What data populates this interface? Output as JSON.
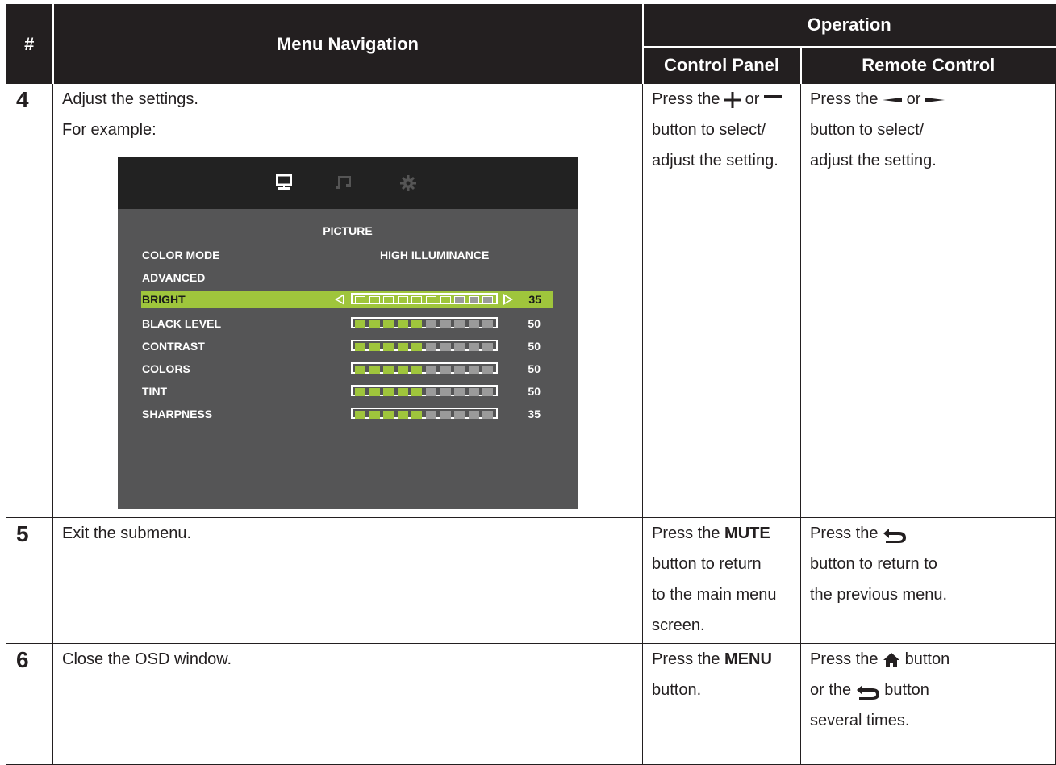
{
  "header": {
    "num": "#",
    "menu_navigation": "Menu Navigation",
    "operation": "Operation",
    "control_panel": "Control Panel",
    "remote_control": "Remote Control"
  },
  "rows": [
    {
      "num": "4",
      "nav": [
        "Adjust the settings.",
        "For example:"
      ],
      "cp": {
        "a": "Press the",
        "b": "or",
        "c": "button to select/",
        "d": "adjust the setting."
      },
      "rc": {
        "a": "Press the",
        "b": "or",
        "c": "button to select/",
        "d": "adjust the setting."
      }
    },
    {
      "num": "5",
      "nav": [
        "Exit the submenu."
      ],
      "cp": {
        "a": "Press the",
        "bold": "MUTE",
        "c": "button to return",
        "d": "to the main menu",
        "e": "screen."
      },
      "rc": {
        "a": "Press the",
        "c": "button to return to",
        "d": "the previous menu."
      }
    },
    {
      "num": "6",
      "nav": [
        "Close the OSD window."
      ],
      "cp": {
        "a": "Press the",
        "bold": "MENU",
        "c": "button."
      },
      "rc": {
        "a": "Press the",
        "b": "button",
        "c": "or the",
        "d": "button",
        "e": "several times."
      }
    }
  ],
  "osd": {
    "tabs": [
      "monitor-icon",
      "music-note-icon",
      "gear-icon"
    ],
    "title": "PICTURE",
    "color_mode_label": "COLOR MODE",
    "color_mode_value": "HIGH ILLUMINANCE",
    "advanced_label": "ADVANCED",
    "sliders": [
      {
        "label": "BRIGHT",
        "value": "35",
        "filled": 0,
        "gray": 3,
        "selected": true
      },
      {
        "label": "BLACK LEVEL",
        "value": "50",
        "filled": 5,
        "gray": 5,
        "selected": false
      },
      {
        "label": "CONTRAST",
        "value": "50",
        "filled": 5,
        "gray": 5,
        "selected": false
      },
      {
        "label": "COLORS",
        "value": "50",
        "filled": 5,
        "gray": 5,
        "selected": false
      },
      {
        "label": "TINT",
        "value": "50",
        "filled": 5,
        "gray": 5,
        "selected": false
      },
      {
        "label": "SHARPNESS",
        "value": "35",
        "filled": 5,
        "gray": 5,
        "selected": false
      }
    ],
    "colors": {
      "accent": "#9fc53c",
      "panel": "#555556",
      "topbar": "#222222"
    }
  },
  "icons": {
    "plus": "plus-icon",
    "minus": "minus-icon",
    "left": "left-arrow-icon",
    "right": "right-arrow-icon",
    "back": "return-icon",
    "home": "home-icon"
  }
}
